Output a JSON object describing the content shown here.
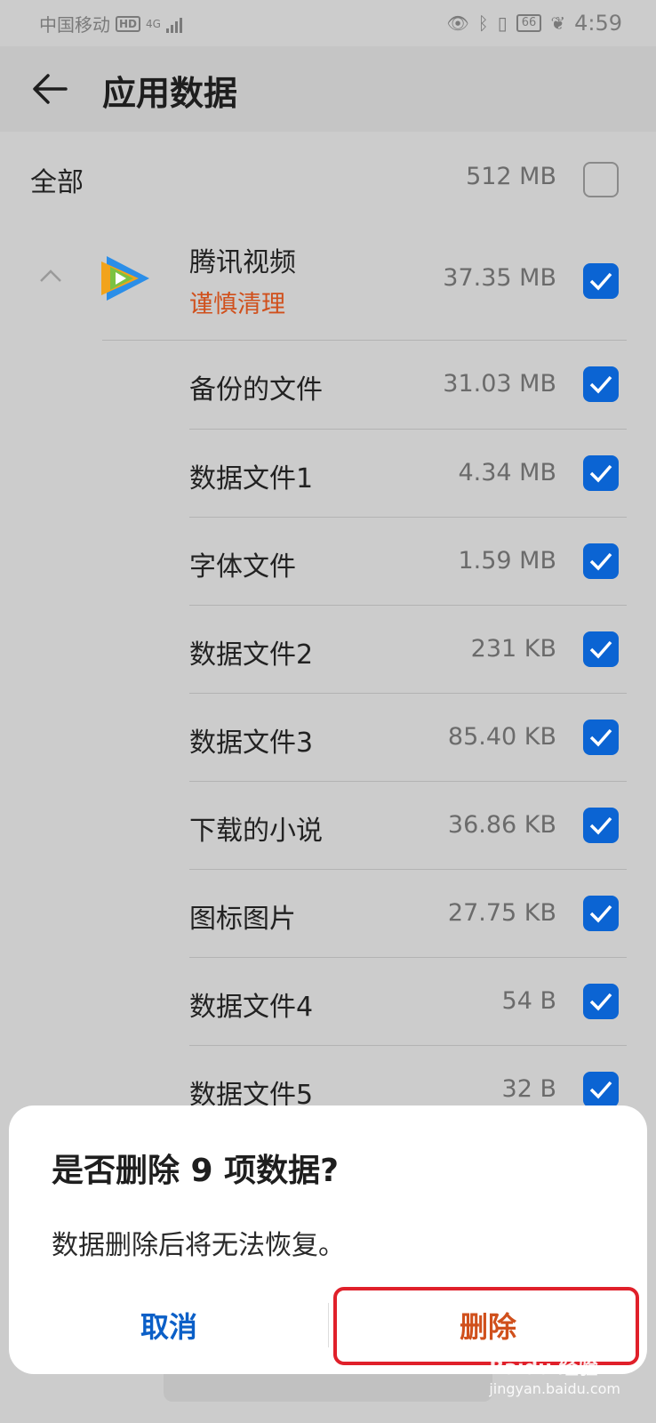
{
  "status": {
    "carrier": "中国移动",
    "hd": "HD",
    "network": "4G",
    "battery": "66",
    "time": "4:59"
  },
  "header": {
    "title": "应用数据"
  },
  "all": {
    "label": "全部",
    "size": "512 MB"
  },
  "app": {
    "name": "腾讯视频",
    "warning": "谨慎清理",
    "size": "37.35 MB"
  },
  "items": [
    {
      "label": "备份的文件",
      "size": "31.03 MB"
    },
    {
      "label": "数据文件1",
      "size": "4.34 MB"
    },
    {
      "label": "字体文件",
      "size": "1.59 MB"
    },
    {
      "label": "数据文件2",
      "size": "231 KB"
    },
    {
      "label": "数据文件3",
      "size": "85.40 KB"
    },
    {
      "label": "下载的小说",
      "size": "36.86 KB"
    },
    {
      "label": "图标图片",
      "size": "27.75 KB"
    },
    {
      "label": "数据文件4",
      "size": "54 B"
    },
    {
      "label": "数据文件5",
      "size": "32 B"
    }
  ],
  "dialog": {
    "title": "是否删除 9 项数据?",
    "message": "数据删除后将无法恢复。",
    "cancel": "取消",
    "delete": "删除"
  },
  "watermark": {
    "brand": "Baidu 经验",
    "site": "jingyan.baidu.com"
  },
  "colors": {
    "accent": "#0b64d3",
    "warning": "#d0501c",
    "highlight": "#e0202a"
  }
}
